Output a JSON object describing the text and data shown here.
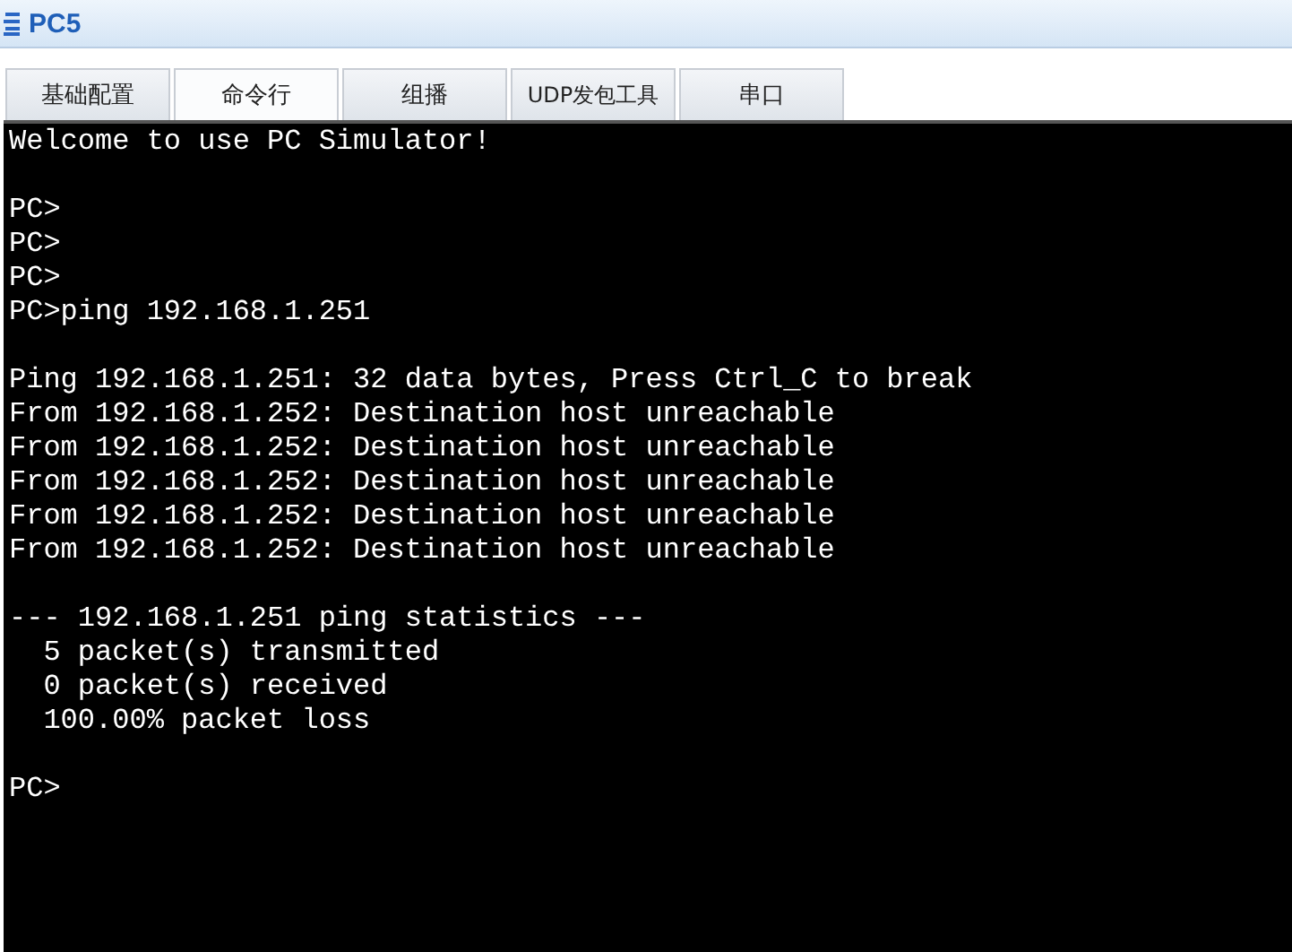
{
  "window": {
    "title": "PC5"
  },
  "tabs": [
    {
      "label": "基础配置",
      "selected": false
    },
    {
      "label": "命令行",
      "selected": true
    },
    {
      "label": "组播",
      "selected": false
    },
    {
      "label": "UDP发包工具",
      "selected": false
    },
    {
      "label": "串口",
      "selected": false
    }
  ],
  "terminal": {
    "blocks": [
      [
        "Welcome to use PC Simulator!"
      ],
      [
        "PC>",
        "PC>",
        "PC>",
        "PC>ping 192.168.1.251"
      ],
      [
        "Ping 192.168.1.251: 32 data bytes, Press Ctrl_C to break",
        "From 192.168.1.252: Destination host unreachable",
        "From 192.168.1.252: Destination host unreachable",
        "From 192.168.1.252: Destination host unreachable",
        "From 192.168.1.252: Destination host unreachable",
        "From 192.168.1.252: Destination host unreachable"
      ],
      [
        "--- 192.168.1.251 ping statistics ---",
        "  5 packet(s) transmitted",
        "  0 packet(s) received",
        "  100.00% packet loss"
      ],
      [
        "PC>"
      ]
    ]
  }
}
